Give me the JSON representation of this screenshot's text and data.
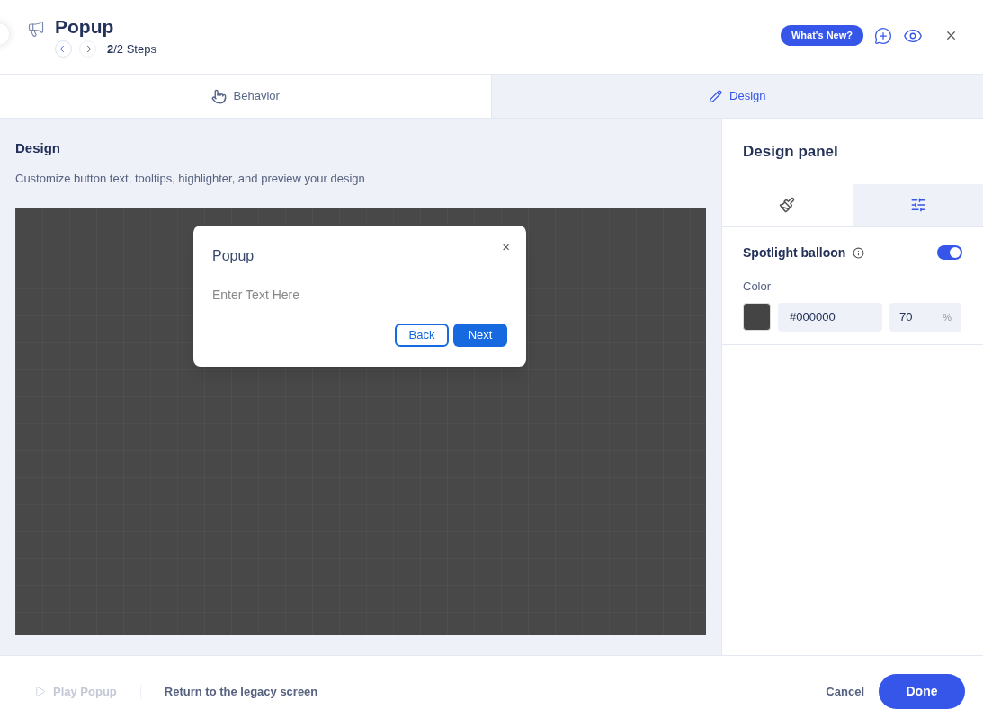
{
  "header": {
    "title": "Popup",
    "steps": "**2**/2 Steps",
    "whats_new": "What's New?"
  },
  "tabs": [
    {
      "label": "Behavior",
      "kind": "hand",
      "selected": false
    },
    {
      "label": "Design",
      "kind": "pencil",
      "selected": true
    }
  ],
  "design": {
    "title": "Design",
    "subtitle": "Customize button text, tooltips, highlighter, and preview your design",
    "popup": {
      "title": "Popup",
      "close": "×",
      "body": "Enter Text Here",
      "buttons": [
        {
          "label": "Back",
          "kind": "outline"
        },
        {
          "label": "Next",
          "kind": "filled"
        }
      ]
    }
  },
  "panel": {
    "title": "Design panel",
    "tabs": [
      {
        "kind": "brush",
        "selected": false
      },
      {
        "kind": "sliders",
        "selected": true
      }
    ],
    "spotlight": {
      "label": "Spotlight balloon",
      "on": true
    },
    "color_label": "Color",
    "color_value": "#000000",
    "opacity": "70",
    "opacity_unit": "%"
  },
  "footer": {
    "play": {
      "label": "Play Popup",
      "disabled": true
    },
    "legacy": "Return to the legacy screen",
    "cancel": "Cancel",
    "done": "Done"
  }
}
